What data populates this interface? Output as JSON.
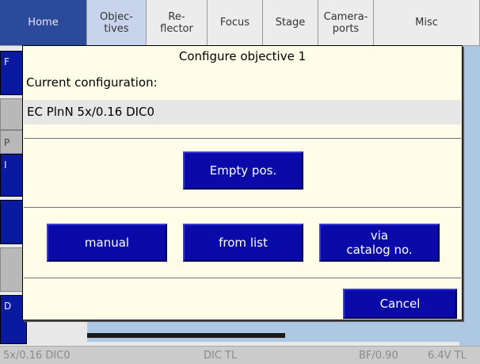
{
  "tabs": [
    {
      "label": "Home"
    },
    {
      "label": "Objec-\ntives"
    },
    {
      "label": "Re-\nflector"
    },
    {
      "label": "Focus"
    },
    {
      "label": "Stage"
    },
    {
      "label": "Camera-\nports"
    },
    {
      "label": "Misc"
    }
  ],
  "left_buttons": [
    "F",
    "P",
    "I",
    "",
    "",
    "D"
  ],
  "statusbar": {
    "objective": "5x/0.16 DIC0",
    "mode": "DIC TL",
    "aperture": "BF/0.90",
    "voltage": "6.4V TL"
  },
  "dialog": {
    "title": "Configure objective 1",
    "current_label": "Current configuration:",
    "current_value": "EC PlnN 5x/0.16 DIC0",
    "empty_button": "Empty pos.",
    "manual_button": "manual",
    "list_button": "from list",
    "catalog_button_line1": "via",
    "catalog_button_line2": "catalog no.",
    "cancel_button": "Cancel"
  },
  "colors": {
    "dialog_bg": "#fffde8",
    "button_blue": "#0a0aa8",
    "home_tab": "#2c4a9a",
    "active_tab": "#c8d4ec"
  }
}
